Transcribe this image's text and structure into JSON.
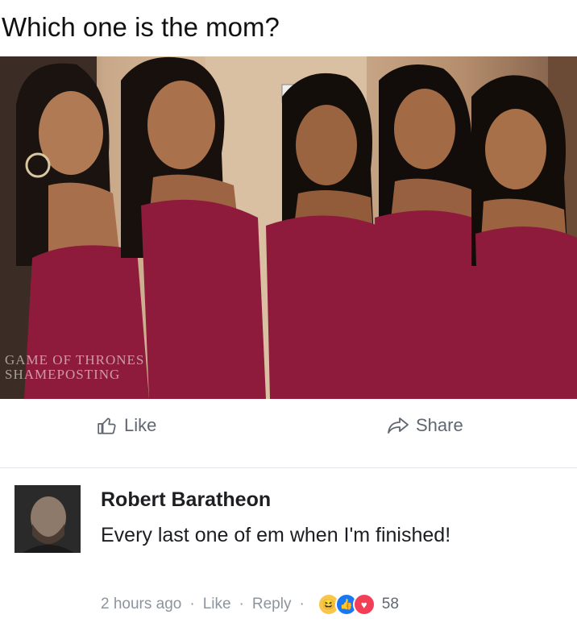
{
  "post": {
    "title": "Which one is the mom?",
    "watermark_line1": "GAME OF THRONES",
    "watermark_line2": "SHAMEPOSTING"
  },
  "actions": {
    "like_label": "Like",
    "share_label": "Share"
  },
  "comment": {
    "author": "Robert Baratheon",
    "text": "Every last one of em when I'm finished!",
    "time": "2 hours ago",
    "like_label": "Like",
    "reply_label": "Reply",
    "separator": "·",
    "reaction_count": "58",
    "reactions": [
      "haha",
      "like",
      "love"
    ]
  },
  "colors": {
    "dress": "#8e1b3c",
    "meta_text": "#8d949e",
    "like_reaction": "#1877f2",
    "love_reaction": "#f33e58",
    "haha_reaction": "#f7c64d"
  }
}
